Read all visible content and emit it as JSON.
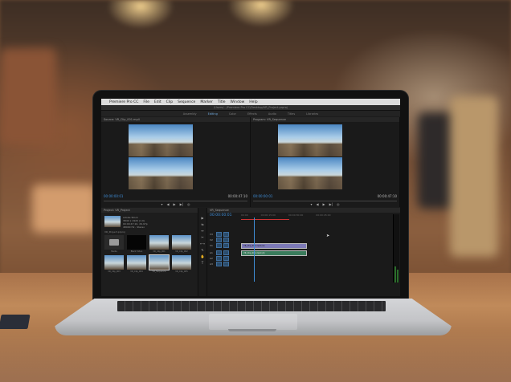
{
  "app": {
    "name": "Premiere Pro CC",
    "menu": [
      "File",
      "Edit",
      "Clip",
      "Sequence",
      "Marker",
      "Title",
      "Window",
      "Help"
    ],
    "window_title": "/Users/.../Premiere Pro CC/Desktop/VR_Project.prproj",
    "workspace_tabs": [
      "Assembly",
      "Editing",
      "Color",
      "Effects",
      "Audio",
      "Titles",
      "Libraries"
    ],
    "active_workspace": "Editing"
  },
  "source_monitor": {
    "header": "Source: VR_Clip_001.mp4",
    "timecode_in": "00:00:00:01",
    "timecode_dur": "00:00:47:10"
  },
  "program_monitor": {
    "header": "Program: VR_Sequence",
    "timecode_in": "00:00:00:01",
    "timecode_dur": "00:00:47:10"
  },
  "transport_icons": [
    "marker-icon",
    "step-back-icon",
    "play-icon",
    "step-forward-icon",
    "export-frame-icon"
  ],
  "transport_glyphs": [
    "▾",
    "◀",
    "▶",
    "▶|",
    "◎"
  ],
  "project_panel": {
    "header": "Project: VR_Project",
    "item_name": "Adobe Stock",
    "item_meta": [
      "3840 x 1920 (1.0)",
      "00:00:47:10, 29.97p",
      "48000 Hz - Stereo"
    ],
    "path": "VR_Project.prproj",
    "items": [
      {
        "type": "bin",
        "label": "Media"
      },
      {
        "type": "black",
        "label": "Black Video"
      },
      {
        "type": "vid",
        "label": "VR_Clip_001"
      },
      {
        "type": "vid",
        "label": "VR_Clip_002"
      },
      {
        "type": "vid",
        "label": "VR_Clip_003"
      },
      {
        "type": "vid",
        "label": "VR_Clip_004"
      },
      {
        "type": "vid",
        "label": "VR_Sequence"
      },
      {
        "type": "vid",
        "label": "VR_Clip_005"
      }
    ]
  },
  "tools": [
    "▶",
    "⇆",
    "↔",
    "✂",
    "⟷",
    "✎",
    "✋",
    "T"
  ],
  "timeline": {
    "header": "VR_Sequence",
    "timecode": "00:00:00:01",
    "ruler": [
      "00:00",
      "00:00:15:00",
      "00:00:30:00",
      "00:00:45:00"
    ],
    "tracks": [
      "V3",
      "V2",
      "V1",
      "A1",
      "A2",
      "A3"
    ],
    "video_clip": "VR_Clip_001.mp4 [V]",
    "audio_clip": "VR_Clip_001.mp4 [A]"
  },
  "colors": {
    "accent_blue": "#3f8ed8",
    "video_clip": "#7d7ab8",
    "audio_clip": "#3a7c5c",
    "work_area": "#cc3333"
  }
}
